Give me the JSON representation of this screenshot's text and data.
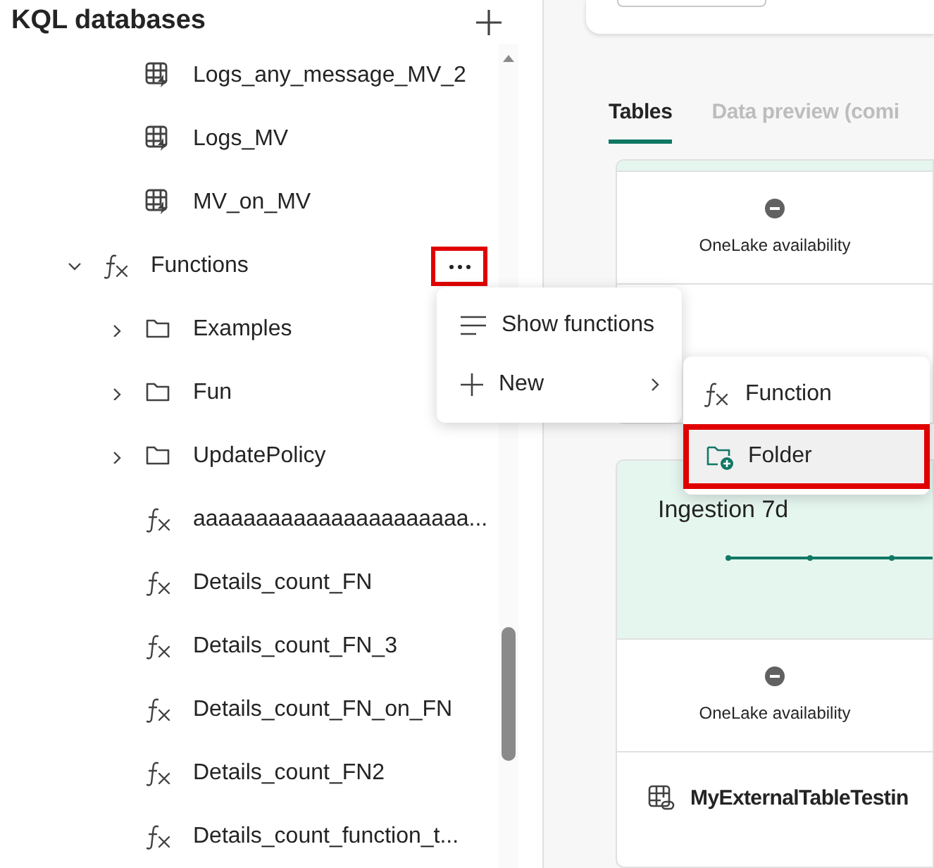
{
  "sidebar": {
    "title": "KQL databases",
    "items": [
      {
        "kind": "table",
        "label": "Logs_any_message_MV_2"
      },
      {
        "kind": "table",
        "label": "Logs_MV"
      },
      {
        "kind": "table",
        "label": "MV_on_MV"
      },
      {
        "kind": "group",
        "label": "Functions",
        "expanded": true,
        "highlighted": true,
        "children": [
          {
            "kind": "folder",
            "label": "Examples",
            "expanded": false
          },
          {
            "kind": "folder",
            "label": "Fun",
            "expanded": false
          },
          {
            "kind": "folder",
            "label": "UpdatePolicy",
            "expanded": false
          },
          {
            "kind": "function",
            "label": "aaaaaaaaaaaaaaaaaaaaaa..."
          },
          {
            "kind": "function",
            "label": "Details_count_FN"
          },
          {
            "kind": "function",
            "label": "Details_count_FN_3"
          },
          {
            "kind": "function",
            "label": "Details_count_FN_on_FN"
          },
          {
            "kind": "function",
            "label": "Details_count_FN2"
          },
          {
            "kind": "function",
            "label": "Details_count_function_t..."
          }
        ]
      }
    ]
  },
  "context_menu": {
    "items": [
      {
        "kind": "list",
        "label": "Show functions"
      },
      {
        "kind": "add",
        "label": "New",
        "submenu": true
      }
    ]
  },
  "submenu": {
    "items": [
      {
        "kind": "function",
        "label": "Function",
        "selected": false
      },
      {
        "kind": "folder",
        "label": "Folder",
        "selected": true
      }
    ]
  },
  "tabs": [
    {
      "label": "Tables",
      "selected": true
    },
    {
      "label": "Data preview (comi",
      "selected": false
    }
  ],
  "cards": [
    {
      "availability": "OneLake availability"
    },
    {
      "chart_title": "Ingestion 7d",
      "availability": "OneLake availability",
      "table_name": "MyExternalTableTestin"
    }
  ]
}
